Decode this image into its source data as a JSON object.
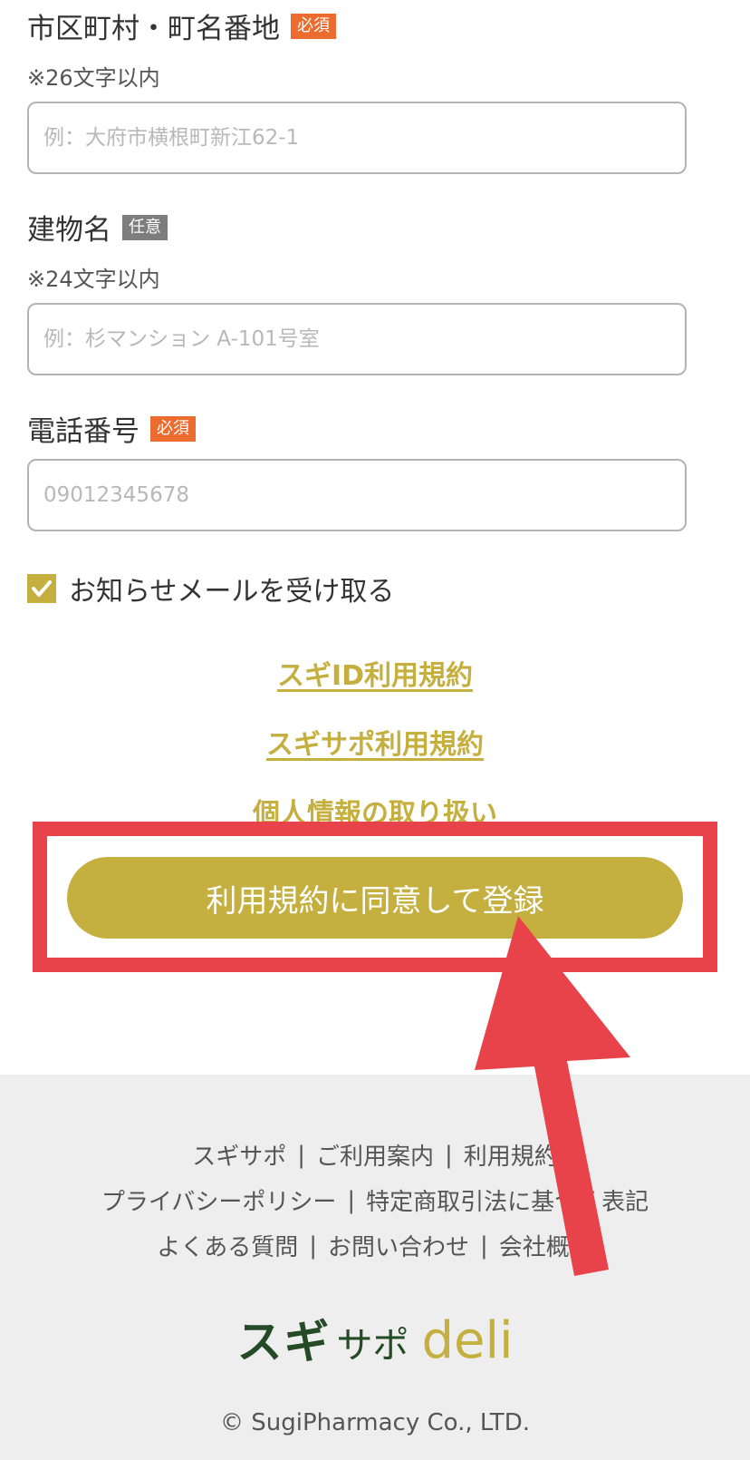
{
  "form": {
    "address_street": {
      "label": "市区町村・町名番地",
      "badge": "必須",
      "hint": "※26文字以内",
      "placeholder": "例：大府市横根町新江62-1",
      "value": ""
    },
    "building": {
      "label": "建物名",
      "badge": "任意",
      "hint": "※24文字以内",
      "placeholder": "例：杉マンション A-101号室",
      "value": ""
    },
    "phone": {
      "label": "電話番号",
      "badge": "必須",
      "placeholder": "09012345678",
      "value": ""
    },
    "newsletter": {
      "label": "お知らせメールを受け取る",
      "checked": true
    }
  },
  "links": {
    "sugi_id_terms": "スギID利用規約",
    "sugisapo_terms": "スギサポ利用規約",
    "privacy_handling": "個人情報の取り扱い"
  },
  "register_button": "利用規約に同意して登録",
  "footer": {
    "nav_row1": [
      "スギサポ",
      "ご利用案内",
      "利用規約"
    ],
    "nav_row2": [
      "プライバシーポリシー",
      "特定商取引法に基づく表記"
    ],
    "nav_row3": [
      "よくある質問",
      "お問い合わせ",
      "会社概要"
    ],
    "logo": {
      "main": "スギ",
      "sub": "サポ",
      "accent": "deli"
    },
    "copyright": "© SugiPharmacy Co., LTD."
  },
  "colors": {
    "accent": "#c4af3f",
    "required_badge": "#ec6b2e",
    "optional_badge": "#7d7d7d",
    "annotation": "#e8434b",
    "logo_green": "#244a26",
    "footer_bg": "#eeeeee"
  },
  "icons": {
    "checkbox_checked": "checkmark-icon",
    "annotation": "arrow-up-icon"
  }
}
